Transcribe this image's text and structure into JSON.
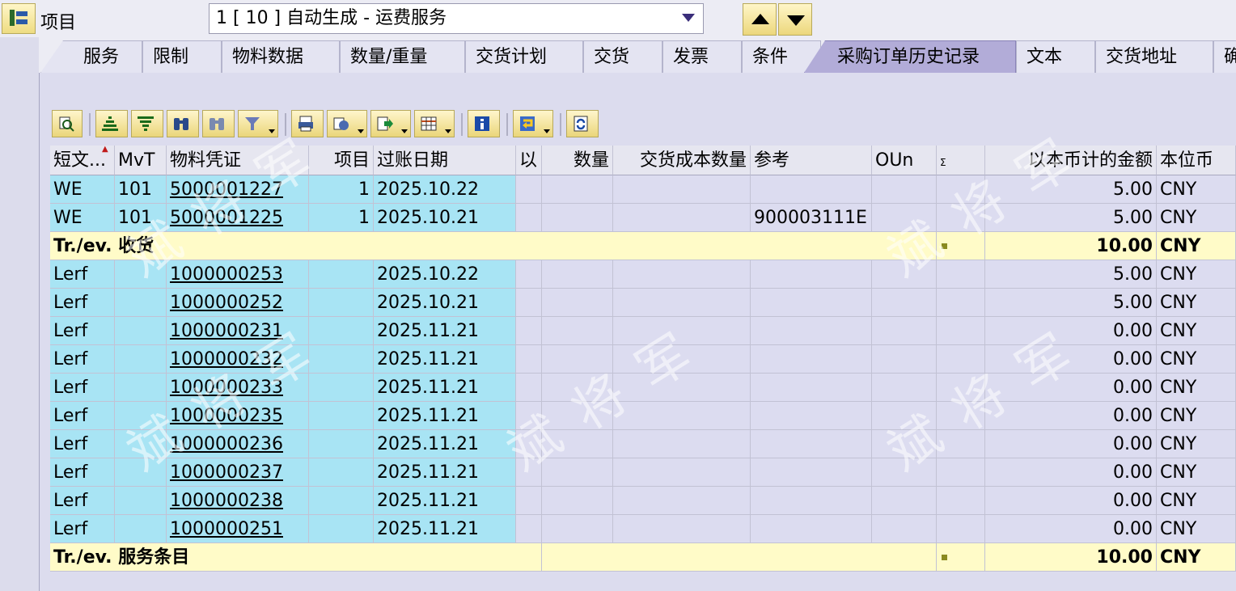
{
  "header": {
    "item_label": "项目",
    "item_selector_value": "1 [ 10 ] 自动生成 - 运费服务"
  },
  "tabs": [
    {
      "label": "服务"
    },
    {
      "label": "限制"
    },
    {
      "label": "物料数据"
    },
    {
      "label": "数量/重量"
    },
    {
      "label": "交货计划"
    },
    {
      "label": "交货"
    },
    {
      "label": "发票"
    },
    {
      "label": "条件"
    },
    {
      "label": "采购订单历史记录",
      "active": true
    },
    {
      "label": "文本"
    },
    {
      "label": "交货地址"
    },
    {
      "label": "确"
    }
  ],
  "toolbar": {
    "icons": [
      "details-icon",
      "sort-ascending-icon",
      "filter-icon",
      "find-icon",
      "find-next-icon",
      "set-filter-icon",
      "print-preview-icon",
      "export-icon",
      "local-file-icon",
      "change-layout-icon",
      "info-icon",
      "display-variant-icon",
      "refresh-icon"
    ]
  },
  "columns": [
    "短文...",
    "MvT",
    "物料凭证",
    "项目",
    "过账日期",
    "以",
    "数量",
    "交货成本数量",
    "参考",
    "OUn",
    "",
    "以本币计的金额",
    "本位币"
  ],
  "rows": [
    {
      "type": "data",
      "shorttext": "WE",
      "mvt": "101",
      "doc": "5000001227",
      "item": "1",
      "date": "2025.10.22",
      "ref": "",
      "amount": "5.00",
      "cur": "CNY"
    },
    {
      "type": "data",
      "shorttext": "WE",
      "mvt": "101",
      "doc": "5000001225",
      "item": "1",
      "date": "2025.10.21",
      "ref": "900003111E",
      "amount": "5.00",
      "cur": "CNY"
    },
    {
      "type": "sum",
      "label_prefix": "Tr./ev.",
      "label": "收货",
      "amount": "10.00",
      "cur": "CNY"
    },
    {
      "type": "data",
      "shorttext": "Lerf",
      "mvt": "",
      "doc": "1000000253",
      "item": "",
      "date": "2025.10.22",
      "ref": "",
      "amount": "5.00",
      "cur": "CNY"
    },
    {
      "type": "data",
      "shorttext": "Lerf",
      "mvt": "",
      "doc": "1000000252",
      "item": "",
      "date": "2025.10.21",
      "ref": "",
      "amount": "5.00",
      "cur": "CNY"
    },
    {
      "type": "data",
      "shorttext": "Lerf",
      "mvt": "",
      "doc": "1000000231",
      "item": "",
      "date": "2025.11.21",
      "ref": "",
      "amount": "0.00",
      "cur": "CNY"
    },
    {
      "type": "data",
      "shorttext": "Lerf",
      "mvt": "",
      "doc": "1000000232",
      "item": "",
      "date": "2025.11.21",
      "ref": "",
      "amount": "0.00",
      "cur": "CNY"
    },
    {
      "type": "data",
      "shorttext": "Lerf",
      "mvt": "",
      "doc": "1000000233",
      "item": "",
      "date": "2025.11.21",
      "ref": "",
      "amount": "0.00",
      "cur": "CNY"
    },
    {
      "type": "data",
      "shorttext": "Lerf",
      "mvt": "",
      "doc": "1000000235",
      "item": "",
      "date": "2025.11.21",
      "ref": "",
      "amount": "0.00",
      "cur": "CNY"
    },
    {
      "type": "data",
      "shorttext": "Lerf",
      "mvt": "",
      "doc": "1000000236",
      "item": "",
      "date": "2025.11.21",
      "ref": "",
      "amount": "0.00",
      "cur": "CNY"
    },
    {
      "type": "data",
      "shorttext": "Lerf",
      "mvt": "",
      "doc": "1000000237",
      "item": "",
      "date": "2025.11.21",
      "ref": "",
      "amount": "0.00",
      "cur": "CNY"
    },
    {
      "type": "data",
      "shorttext": "Lerf",
      "mvt": "",
      "doc": "1000000238",
      "item": "",
      "date": "2025.11.21",
      "ref": "",
      "amount": "0.00",
      "cur": "CNY"
    },
    {
      "type": "data",
      "shorttext": "Lerf",
      "mvt": "",
      "doc": "1000000251",
      "item": "",
      "date": "2025.11.21",
      "ref": "",
      "amount": "0.00",
      "cur": "CNY"
    },
    {
      "type": "sum",
      "label_prefix": "Tr./ev.",
      "label": "服务条目",
      "amount": "10.00",
      "cur": "CNY"
    }
  ],
  "watermark": "斌将军",
  "colors": {
    "key_cell": "#a8e4f4",
    "sum_row": "#fffbc8",
    "active_tab": "#b2acd8"
  }
}
